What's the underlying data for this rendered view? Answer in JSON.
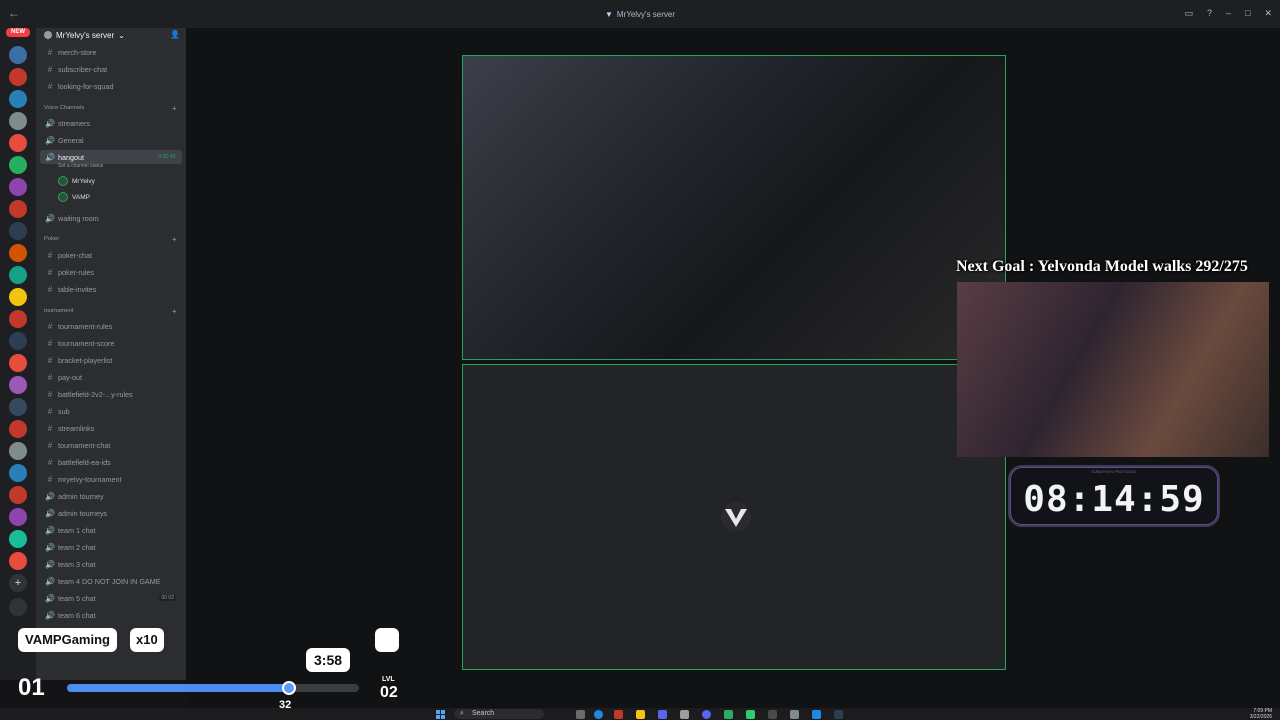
{
  "window": {
    "title": "MrYelvy's server"
  },
  "server": {
    "name": "MrYelvy's server",
    "new_label": "NEW"
  },
  "channels": {
    "top": [
      "merch-store",
      "subscriber-chat",
      "looking-for-squad"
    ],
    "voice_category": "Voice Channels",
    "voice": [
      "streamers",
      "General"
    ],
    "hangout": {
      "name": "hangout",
      "timer": "0:11:41",
      "status": "Set a channel status"
    },
    "voice_users": [
      "MrYelvy",
      "VAMP"
    ],
    "waiting": "waiting room",
    "poker_category": "Poker",
    "poker": [
      "poker-chat",
      "poker-rules",
      "table-invites"
    ],
    "tournament_category": "tournament",
    "tournament": [
      "tournament-rules",
      "tournament-score",
      "bracket-playerlist",
      "pay-out",
      "battlefield-2v2-...y-rules",
      "sub",
      "streamlinks",
      "tournament-chat",
      "battlefield-ea-ids",
      "mryelvy-tournament"
    ],
    "tournament_voice": [
      "admin tourney",
      "admin tourneys",
      "team 1 chat",
      "team 2 chat",
      "team 3 chat",
      "team 4 DO NOT JOIN IN GAME",
      "team 5 chat",
      "team 6 chat"
    ],
    "team5_pill": "00 02"
  },
  "overlay": {
    "goal": "Next Goal : Yelvonda Model walks 292/275",
    "countdown": "08:14:59",
    "countdown_label": "SUBATHON PROTOCOL",
    "user": "VAMPGaming",
    "multiplier": "x10",
    "session_time": "3:58",
    "level_current": "01",
    "level_label": "LVL",
    "level_next": "02",
    "progress_value": "32",
    "progress_fraction": 0.76
  },
  "taskbar": {
    "search": "Search",
    "time": "7:09 PM",
    "date": "3/22/2026"
  },
  "colors": {
    "accent_green": "#23a55a",
    "progress_blue": "#4d8ef0",
    "sidebar": "#2b2d31"
  }
}
